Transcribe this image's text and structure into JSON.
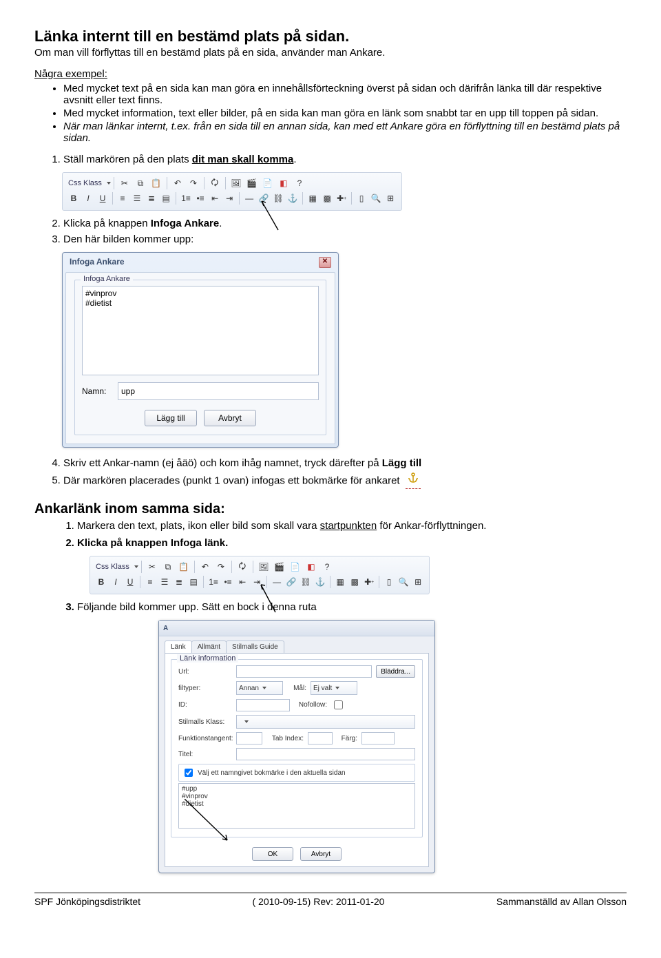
{
  "heading": "Länka internt till en bestämd plats på sidan.",
  "subheading": "Om man vill förflyttas till en bestämd plats på en sida, använder man Ankare.",
  "examples_label": "Några exempel:",
  "bullets": [
    "Med mycket text på en sida kan man göra en innehållsförteckning överst på sidan och därifrån länka till där respektive avsnitt eller text finns.",
    "Med mycket information, text eller bilder, på en sida kan man göra en länk som snabbt tar en upp till toppen på sidan.",
    "När man länkar internt, t.ex. från en sida till en annan sida, kan med ett Ankare göra en förflyttning till en bestämd plats på sidan."
  ],
  "steps": {
    "s1_pre": "Ställ markören på den plats ",
    "s1_u": "dit man skall komma",
    "s1_post": ".",
    "s2_pre": "Klicka på knappen ",
    "s2_b": "Infoga Ankare",
    "s2_post": ".",
    "s3": "Den här bilden kommer upp:",
    "s4_pre": "Skriv ett Ankar-namn (ej åäö) och kom ihåg namnet, tryck därefter på ",
    "s4_b": "Lägg till",
    "s5_pre": "Där markören placerades (punkt 1 ovan) infogas ett bokmärke för ankaret"
  },
  "toolbar": {
    "css_label": "Css Klass"
  },
  "dlg1": {
    "title": "Infoga Ankare",
    "legend": "Infoga Ankare",
    "items": [
      "#vinprov",
      "#dietist"
    ],
    "name_label": "Namn:",
    "name_value": "upp",
    "btn_add": "Lägg till",
    "btn_cancel": "Avbryt"
  },
  "section2_heading": "Ankarlänk inom samma sida:",
  "s2list": {
    "i1_pre": "Markera den text, plats, ikon eller bild som skall vara ",
    "i1_u": "startpunkten",
    "i1_post": " för Ankar-förflyttningen.",
    "i2_pre": "Klicka på knappen ",
    "i2_b": "Infoga länk",
    "i2_post": ".",
    "i3": "Följande bild kommer upp. Sätt en bock i denna ruta"
  },
  "dlg2": {
    "title": "A",
    "tabs": [
      "Länk",
      "Allmänt",
      "Stilmalls Guide"
    ],
    "grp": "Länk information",
    "url": "Url:",
    "filtyper": "filtyper:",
    "filtyper_v": "Annan",
    "mal": "Mål:",
    "mal_v": "Ej valt",
    "bladdra": "Bläddra...",
    "id": "ID:",
    "nofollow": "Nofollow:",
    "stilklass": "Stilmalls Klass:",
    "funktang": "Funktionstangent:",
    "tabidx": "Tab Index:",
    "farg": "Färg:",
    "titel": "Titel:",
    "chk_label": "Välj ett namngivet bokmärke i den aktuella sidan",
    "list": [
      "#upp",
      "#vinprov",
      "#dietist"
    ],
    "ok": "OK",
    "cancel": "Avbryt"
  },
  "footer": {
    "left": "SPF Jönköpingsdistriktet",
    "center": "( 2010-09-15) Rev: 2011-01-20",
    "right": "Sammanställd av Allan Olsson"
  }
}
